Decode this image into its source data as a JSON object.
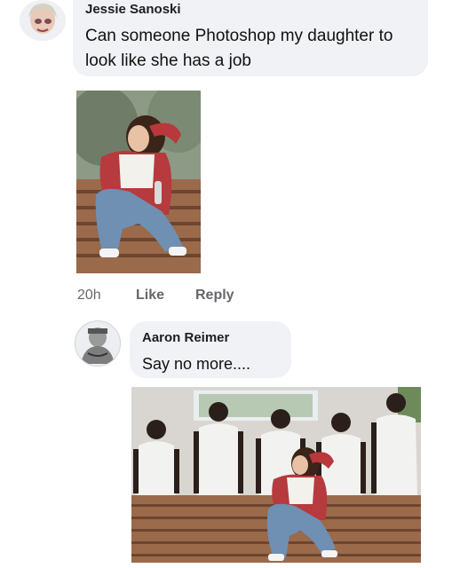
{
  "comment1": {
    "author": "Jessie Sanoski",
    "text": "Can someone Photoshop my daughter to look like she has a job",
    "time": "20h",
    "like_label": "Like",
    "reply_label": "Reply"
  },
  "comment2": {
    "author": "Aaron Reimer",
    "text": "Say no more...."
  }
}
